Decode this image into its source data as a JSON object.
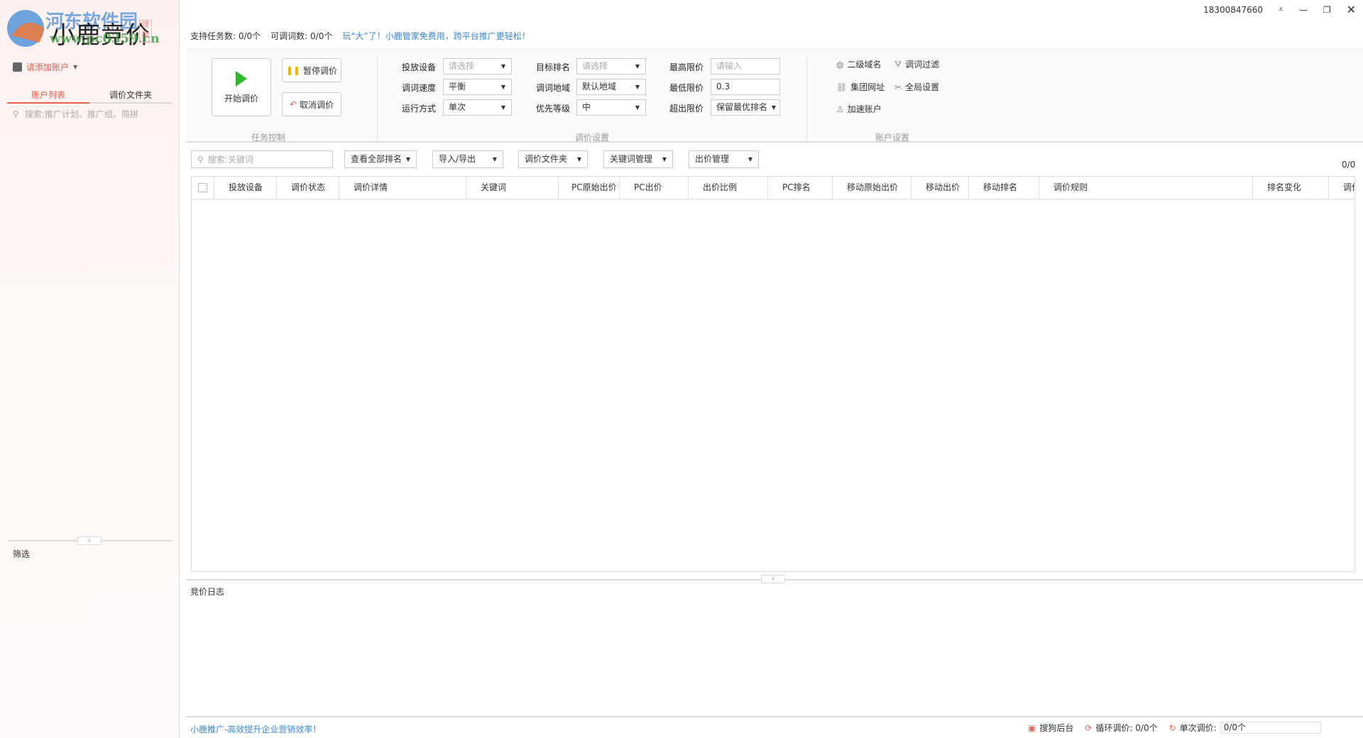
{
  "app": {
    "logo_text": "小鹿竞价",
    "watermark": "河东软件园",
    "watermark_url": "www.pc0359.cn",
    "watermark_badge": "搜狗"
  },
  "sidebar": {
    "add_account": "请添加账户",
    "tabs": [
      {
        "label": "账户列表",
        "active": true
      },
      {
        "label": "调价文件夹",
        "active": false
      }
    ],
    "search_placeholder": "搜索:推广计划、推广组、简拼",
    "filter_label": "筛选"
  },
  "window": {
    "user_phone": "18300847660"
  },
  "info": {
    "task_count": "支持任务数: 0/0个",
    "keyword_count": "可调词数: 0/0个",
    "promo": "玩“大”了！小鹿管家免费用，跨平台推广更轻松！"
  },
  "task_control": {
    "start": "开始调价",
    "pause": "暂停调价",
    "cancel": "取消调价",
    "caption": "任务控制"
  },
  "price_settings": {
    "caption": "调价设置",
    "device": {
      "label": "投放设备",
      "value": "请选择",
      "placeholder": true
    },
    "speed": {
      "label": "调词速度",
      "value": "平衡"
    },
    "run_mode": {
      "label": "运行方式",
      "value": "单次"
    },
    "target_rank": {
      "label": "目标排名",
      "value": "请选择",
      "placeholder": true
    },
    "region": {
      "label": "调词地域",
      "value": "默认地域"
    },
    "priority": {
      "label": "优先等级",
      "value": "中"
    },
    "max_price": {
      "label": "最高限价",
      "value": "",
      "placeholder": "请输入"
    },
    "min_price": {
      "label": "最低限价",
      "value": "0.3"
    },
    "over_limit": {
      "label": "超出限价",
      "value": "保留最优排名"
    }
  },
  "account_settings": {
    "caption": "账户设置",
    "items": [
      "二级域名",
      "调词过滤",
      "集团网址",
      "全局设置",
      "加速账户"
    ]
  },
  "filterbar": {
    "search_placeholder": "搜索:关键词",
    "buttons": [
      "查看全部排名",
      "导入/导出",
      "调价文件夹",
      "关键词管理",
      "出价管理"
    ],
    "count": "0/0"
  },
  "table": {
    "columns": [
      "投放设备",
      "调价状态",
      "调价详情",
      "关键词",
      "PC原始出价",
      "PC出价",
      "出价比例",
      "PC排名",
      "移动原始出价",
      "移动出价",
      "移动排名",
      "调价规则",
      "排名变化",
      "调价"
    ],
    "rows": []
  },
  "log": {
    "title": "竞价日志"
  },
  "footer": {
    "slogan": "小鹿推广-高效提升企业营销效率！",
    "sogou": "搜狗后台",
    "loop": "循环调价: 0/0个",
    "once_label": "单次调价:",
    "once_value": "0/0个"
  },
  "colors": {
    "accent": "#e8604c",
    "link": "#3b86d4",
    "play": "#2db82d",
    "pause": "#f0b400"
  }
}
